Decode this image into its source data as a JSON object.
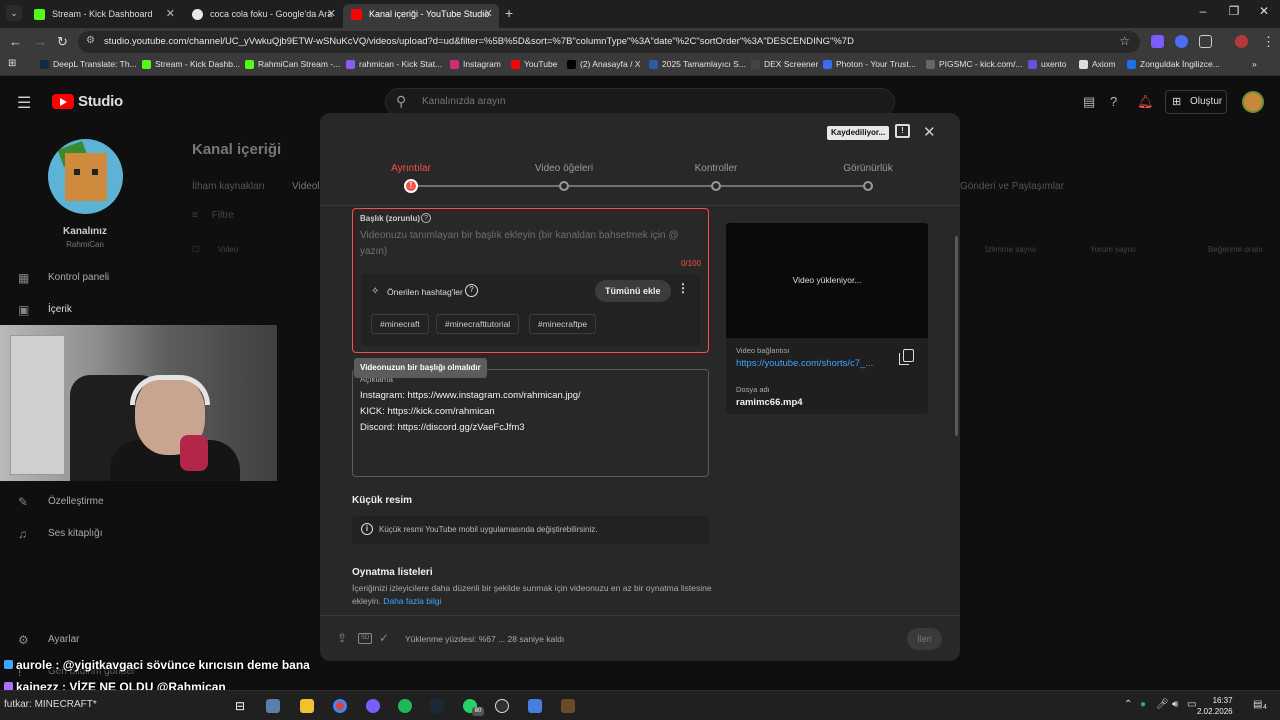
{
  "browser": {
    "tabs": [
      {
        "title": "Stream - Kick Dashboard",
        "color": "#53fc18"
      },
      {
        "title": "coca cola foku - Google'da Ara",
        "color": "#e8e8e8"
      },
      {
        "title": "Kanal içeriği - YouTube Studio",
        "color": "#ff0000"
      }
    ],
    "new_tab": "+",
    "url": "studio.youtube.com/channel/UC_yVwkuQjb9ETW-wSNuKcVQ/videos/upload?d=ud&filter=%5B%5D&sort=%7B\"columnType\"%3A\"date\"%2C\"sortOrder\"%3A\"DESCENDING\"%7D",
    "bookmarks": [
      {
        "label": "DeepL Translate: Th...",
        "color": "#0f2b46"
      },
      {
        "label": "Stream - Kick Dashb...",
        "color": "#53fc18"
      },
      {
        "label": "RahmiCan Stream -...",
        "color": "#53fc18"
      },
      {
        "label": "rahmican - Kick Stat...",
        "color": "#8a5cf6"
      },
      {
        "label": "Instagram",
        "color": "#d62976"
      },
      {
        "label": "YouTube",
        "color": "#ff0000"
      },
      {
        "label": "(2) Anasayfa / X",
        "color": "#000000"
      },
      {
        "label": "2025 Tamamlayıcı S...",
        "color": "#2e5aa8"
      },
      {
        "label": "DEX Screener",
        "color": "#444444"
      },
      {
        "label": "Photon - Your Trust...",
        "color": "#3a6df0"
      },
      {
        "label": "PIGSMC - kick.com/...",
        "color": "#666666"
      },
      {
        "label": "uxento",
        "color": "#6b4fd8"
      },
      {
        "label": "Axiom",
        "color": "#dddddd"
      },
      {
        "label": "Zonguldak İngilizce...",
        "color": "#1a73e8"
      }
    ]
  },
  "studio": {
    "logo": "Studio",
    "search_placeholder": "Kanalınızda arayın",
    "create_label": "Oluştur",
    "channel_title": "Kanalınız",
    "channel_name": "RahmiCan",
    "nav": [
      {
        "label": "Kontrol paneli",
        "icon": "dashboard-icon"
      },
      {
        "label": "İçerik",
        "icon": "content-icon"
      },
      {
        "label": "Özelleştirme",
        "icon": "customization-icon"
      },
      {
        "label": "Ses kitaplığı",
        "icon": "audio-library-icon"
      },
      {
        "label": "Ayarlar",
        "icon": "settings-icon"
      },
      {
        "label": "Geri bildirim gönder",
        "icon": "feedback-icon"
      }
    ],
    "page_title": "Kanal içeriği",
    "content_tabs": [
      "İlham kaynakları",
      "Videolar",
      "Gönderi ve Paylaşımlar"
    ],
    "filter_label": "Filtre",
    "columns": [
      "Video",
      "İzlenme sayısı",
      "Yorum sayısı",
      "Beğenme oranı"
    ]
  },
  "dialog": {
    "saving_badge": "Kaydediliyor...",
    "steps": [
      {
        "label": "Ayrıntılar",
        "active": true
      },
      {
        "label": "Video öğeleri",
        "active": false
      },
      {
        "label": "Kontroller",
        "active": false
      },
      {
        "label": "Görünürlük",
        "active": false
      }
    ],
    "title_field": {
      "label": "Başlık (zorunlu)",
      "placeholder": "Videonuzu tanımlayan bir başlık ekleyin (bir kanaldan bahsetmek için @ yazın)",
      "counter": "0/100"
    },
    "hashtags": {
      "label": "Önerilen hashtag'ler",
      "add_all": "Tümünü ekle",
      "chips": [
        "#minecraft",
        "#minecrafttutorial",
        "#minecraftpe"
      ]
    },
    "title_error": "Videonuzun bir başlığı olmalıdır",
    "description": {
      "label": "Açıklama",
      "lines": [
        "Instagram: https://www.instagram.com/rahmican.jpg/",
        "KICK: https://kick.com/rahmican",
        "Discord: https://discord.gg/zVaeFcJfm3"
      ]
    },
    "video_card": {
      "status": "Video yükleniyor...",
      "link_label": "Video bağlantısı",
      "link": "https://youtube.com/shorts/c7_...",
      "file_label": "Dosya adı",
      "file_name": "ramimc66.mp4"
    },
    "thumbnail": {
      "title": "Küçük resim",
      "info": "Küçük resmi YouTube mobil uygulamasında değiştirebilirsiniz."
    },
    "playlists": {
      "title": "Oynatma listeleri",
      "text": "İçeriğinizi izleyicilere daha düzenli bir şekilde sunmak için videonuzu en az bir oynatma listesine ekleyin.",
      "link": "Daha fazla bilgi"
    },
    "footer": {
      "sd_label": "SD",
      "status": "Yüklenme yüzdesi: %67 ... 28 saniye kaldı",
      "next_label": "İleri"
    }
  },
  "chat": [
    {
      "user": "aurole",
      "message": ": @yigitkavgaci sövünce kırıcısın deme bana",
      "badge_color": "#3ea6ff"
    },
    {
      "user": "kainezz",
      "message": ": VİZE NE OLDU @Rahmican",
      "badge_color": "#a970ff"
    }
  ],
  "taskbar": {
    "weather_text": "futkar: MINECRAFT*",
    "tray_badge": "80",
    "time": "16:37",
    "date": "2.02.2026",
    "notification_count": "4"
  }
}
